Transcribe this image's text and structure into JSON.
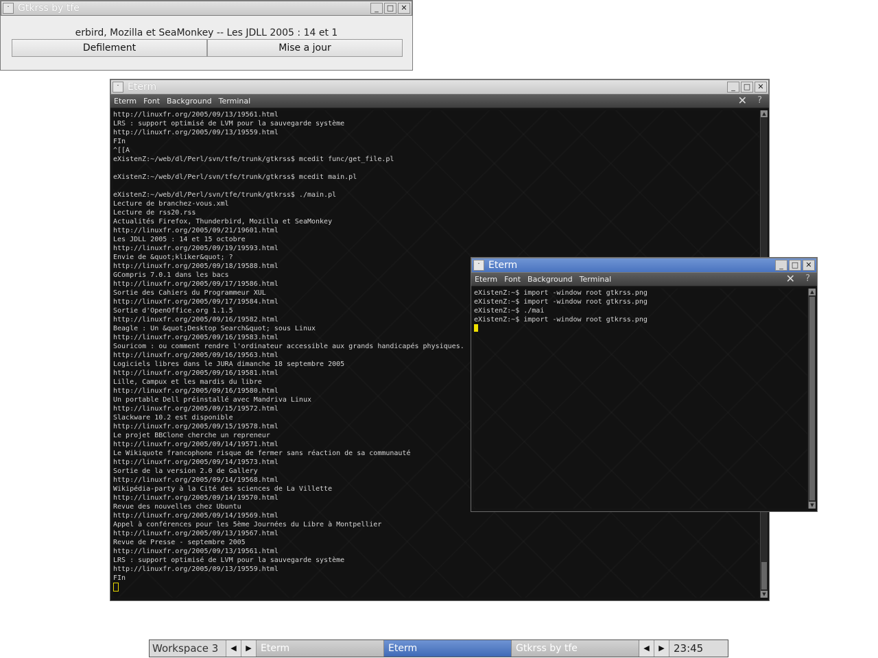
{
  "gtkrss": {
    "title": "Gtkrss by tfe",
    "ticker": "erbird, Mozilla et SeaMonkey -- Les JDLL 2005 : 14 et 1",
    "buttons": [
      "Defilement",
      "Mise a jour"
    ]
  },
  "eterm_main": {
    "title": "Eterm",
    "menu": [
      "Eterm",
      "Font",
      "Background",
      "Terminal"
    ],
    "lines": [
      "http://linuxfr.org/2005/09/13/19561.html",
      "LRS : support optimisé de LVM pour la sauvegarde système",
      "http://linuxfr.org/2005/09/13/19559.html",
      "FIn",
      "^[[A",
      "eXistenZ:~/web/dl/Perl/svn/tfe/trunk/gtkrss$ mcedit func/get_file.pl",
      "",
      "eXistenZ:~/web/dl/Perl/svn/tfe/trunk/gtkrss$ mcedit main.pl",
      "",
      "eXistenZ:~/web/dl/Perl/svn/tfe/trunk/gtkrss$ ./main.pl",
      "Lecture de branchez-vous.xml",
      "Lecture de rss20.rss",
      "Actualités Firefox, Thunderbird, Mozilla et SeaMonkey",
      "http://linuxfr.org/2005/09/21/19601.html",
      "Les JDLL 2005 : 14 et 15 octobre",
      "http://linuxfr.org/2005/09/19/19593.html",
      "Envie de &quot;kliker&quot; ?",
      "http://linuxfr.org/2005/09/18/19588.html",
      "GCompris 7.0.1 dans les bacs",
      "http://linuxfr.org/2005/09/17/19586.html",
      "Sortie des Cahiers du Programmeur XUL",
      "http://linuxfr.org/2005/09/17/19584.html",
      "Sortie d'OpenOffice.org 1.1.5",
      "http://linuxfr.org/2005/09/16/19582.html",
      "Beagle : Un &quot;Desktop Search&quot; sous Linux",
      "http://linuxfr.org/2005/09/16/19583.html",
      "Souricom : ou comment rendre l'ordinateur accessible aux grands handicapés physiques.",
      "http://linuxfr.org/2005/09/16/19563.html",
      "Logiciels libres dans le JURA dimanche 18 septembre 2005",
      "http://linuxfr.org/2005/09/16/19581.html",
      "Lille, Campux et les mardis du libre",
      "http://linuxfr.org/2005/09/16/19580.html",
      "Un portable Dell préinstallé avec Mandriva Linux",
      "http://linuxfr.org/2005/09/15/19572.html",
      "Slackware 10.2 est disponible",
      "http://linuxfr.org/2005/09/15/19578.html",
      "Le projet BBClone cherche un repreneur",
      "http://linuxfr.org/2005/09/14/19571.html",
      "Le Wikiquote francophone risque de fermer sans réaction de sa communauté",
      "http://linuxfr.org/2005/09/14/19573.html",
      "Sortie de la version 2.0 de Gallery",
      "http://linuxfr.org/2005/09/14/19568.html",
      "Wikipédia-party à la Cité des sciences de La Villette",
      "http://linuxfr.org/2005/09/14/19570.html",
      "Revue des nouvelles chez Ubuntu",
      "http://linuxfr.org/2005/09/14/19569.html",
      "Appel à conférences pour les 5ème Journées du Libre à Montpellier",
      "http://linuxfr.org/2005/09/13/19567.html",
      "Revue de Presse - septembre 2005",
      "http://linuxfr.org/2005/09/13/19561.html",
      "LRS : support optimisé de LVM pour la sauvegarde système",
      "http://linuxfr.org/2005/09/13/19559.html",
      "FIn"
    ],
    "cursor_color": "#e8d800"
  },
  "eterm_small": {
    "title": "Eterm",
    "menu": [
      "Eterm",
      "Font",
      "Background",
      "Terminal"
    ],
    "lines": [
      "eXistenZ:~$ import -window root gtkrss.png",
      "eXistenZ:~$ import -window root gtkrss.png",
      "eXistenZ:~$ ./mai",
      "eXistenZ:~$ import -window root gtkrss.png"
    ],
    "cursor_color": "#f0e000"
  },
  "taskbar": {
    "workspace": "Workspace 3",
    "tasks": [
      "Eterm",
      "Eterm",
      "Gtkrss by tfe"
    ],
    "active_task_index": 1,
    "clock": "23:45",
    "accent": "#4a74bf"
  }
}
